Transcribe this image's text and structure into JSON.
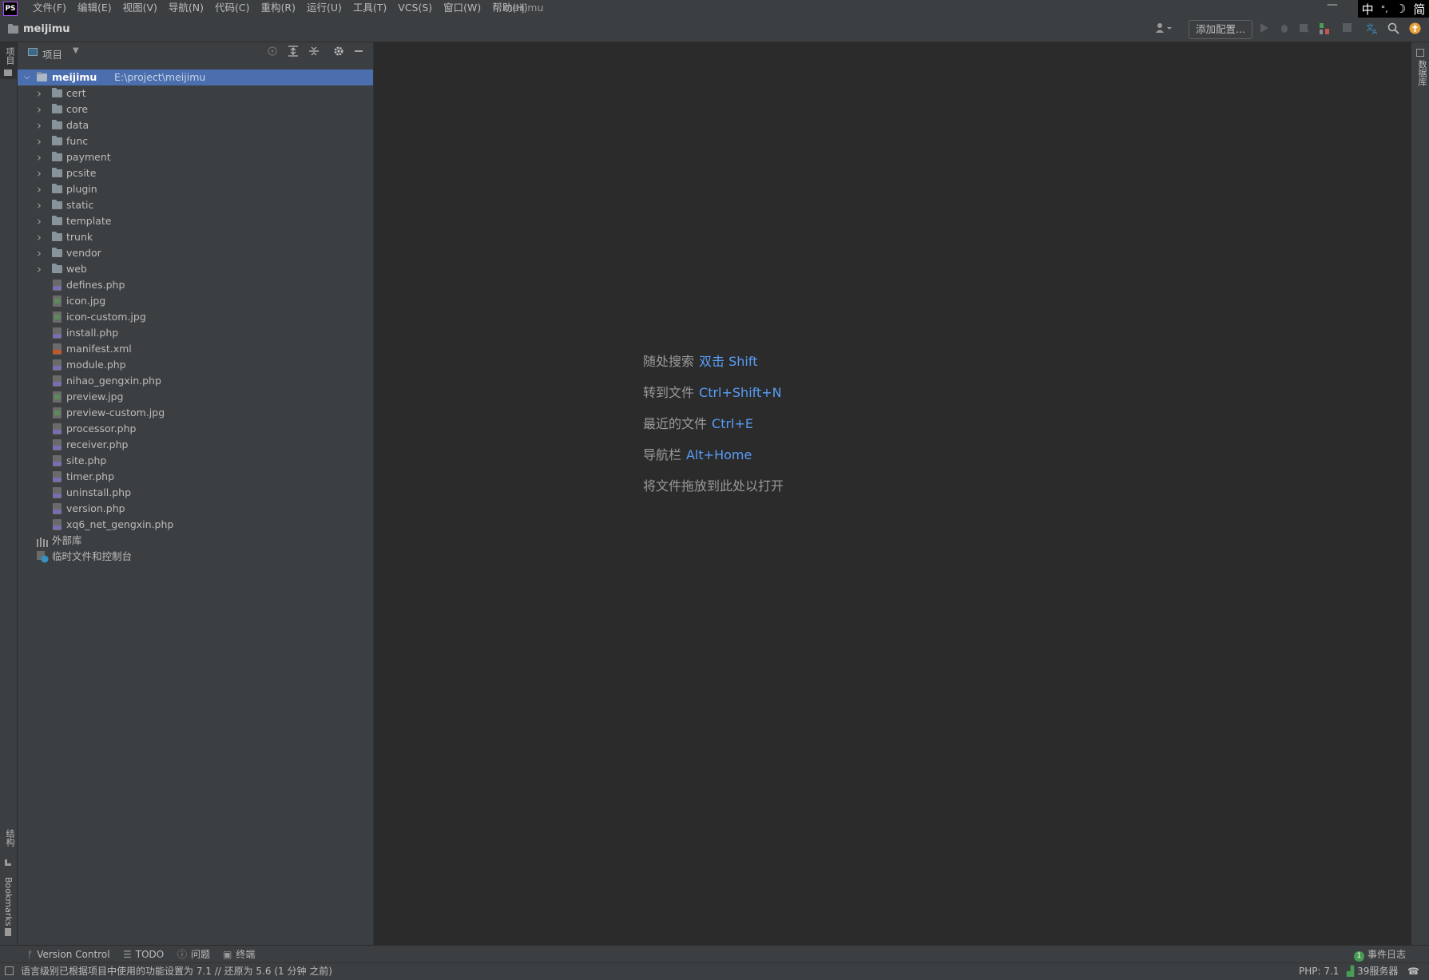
{
  "app": {
    "logo": "PS",
    "window_title": "meijimu"
  },
  "menu": [
    "文件(F)",
    "编辑(E)",
    "视图(V)",
    "导航(N)",
    "代码(C)",
    "重构(R)",
    "运行(U)",
    "工具(T)",
    "VCS(S)",
    "窗口(W)",
    "帮助(H)"
  ],
  "ime": [
    "中",
    "°,",
    "☽",
    "简"
  ],
  "navbar": {
    "breadcrumb": "meijimu",
    "add_config": "添加配置..."
  },
  "left_strip": {
    "project_tab": "项目",
    "structure_tab": "结构",
    "bookmarks_tab": "Bookmarks"
  },
  "right_strip": {
    "database_tab": "数据库"
  },
  "project_panel": {
    "title": "项目",
    "root": {
      "name": "meijimu",
      "path": "E:\\project\\meijimu"
    },
    "folders": [
      "cert",
      "core",
      "data",
      "func",
      "payment",
      "pcsite",
      "plugin",
      "static",
      "template",
      "trunk",
      "vendor",
      "web"
    ],
    "files": [
      {
        "name": "defines.php",
        "type": "php"
      },
      {
        "name": "icon.jpg",
        "type": "jpg"
      },
      {
        "name": "icon-custom.jpg",
        "type": "jpg"
      },
      {
        "name": "install.php",
        "type": "php"
      },
      {
        "name": "manifest.xml",
        "type": "xml"
      },
      {
        "name": "module.php",
        "type": "php"
      },
      {
        "name": "nihao_gengxin.php",
        "type": "php"
      },
      {
        "name": "preview.jpg",
        "type": "jpg"
      },
      {
        "name": "preview-custom.jpg",
        "type": "jpg"
      },
      {
        "name": "processor.php",
        "type": "php"
      },
      {
        "name": "receiver.php",
        "type": "php"
      },
      {
        "name": "site.php",
        "type": "php"
      },
      {
        "name": "timer.php",
        "type": "php"
      },
      {
        "name": "uninstall.php",
        "type": "php"
      },
      {
        "name": "version.php",
        "type": "php"
      },
      {
        "name": "xq6_net_gengxin.php",
        "type": "php"
      }
    ],
    "external_libs": "外部库",
    "scratches": "临时文件和控制台"
  },
  "welcome": [
    {
      "label": "随处搜索",
      "key": "双击 Shift"
    },
    {
      "label": "转到文件",
      "key": "Ctrl+Shift+N"
    },
    {
      "label": "最近的文件",
      "key": "Ctrl+E"
    },
    {
      "label": "导航栏",
      "key": "Alt+Home"
    },
    {
      "label": "将文件拖放到此处以打开",
      "key": ""
    }
  ],
  "bottom_tabs": {
    "version_control": "Version Control",
    "todo": "TODO",
    "problems": "问题",
    "terminal": "终端",
    "event_log": "事件日志",
    "event_count": "1"
  },
  "status": {
    "message": "语言级别已根据项目中使用的功能设置为 7.1 // 还原为 5.6 (1 分钟 之前)",
    "php_version": "PHP: 7.1",
    "server": "39服务器"
  },
  "colors": {
    "accent": "#589df6",
    "selection": "#4b6eaf",
    "panel": "#3c3f41",
    "editor": "#2b2b2b"
  }
}
